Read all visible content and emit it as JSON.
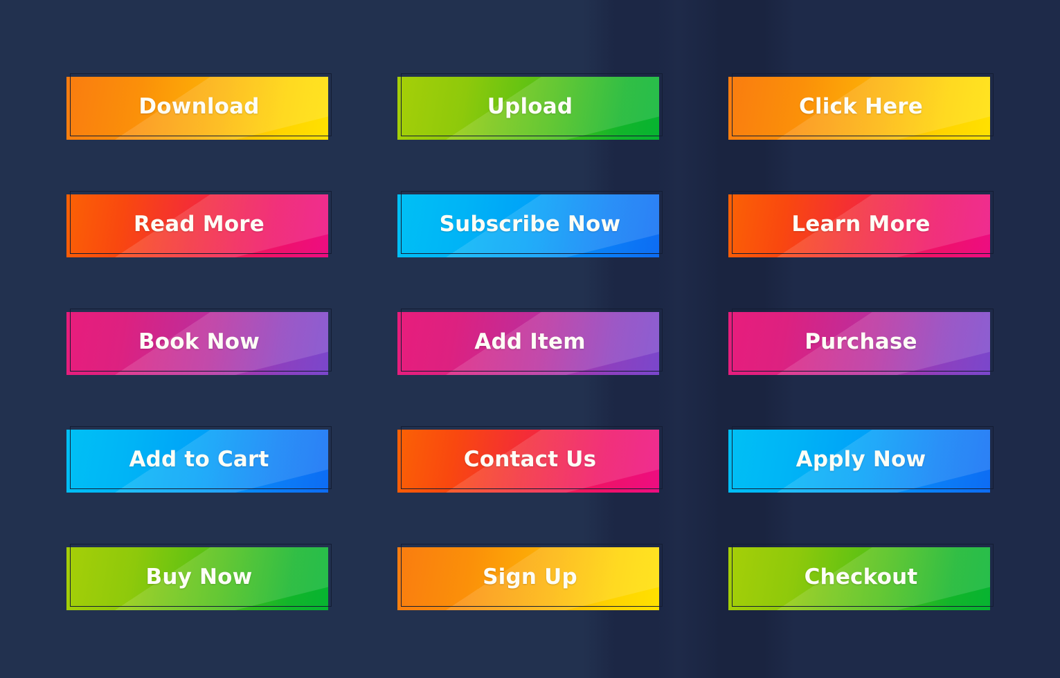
{
  "page": {
    "title": "Gradient Call-To-Action Button Set",
    "background_color": "#1e2a47",
    "columns": 3,
    "rows": 5,
    "total_buttons": 15
  },
  "palette": {
    "orange_yellow": "#f97c10 → #ffe100",
    "lime_green": "#a6cf08 → #06b431",
    "orange_pink": "#fb6205 → #ed0d81",
    "cyan_blue": "#00c0f5 → #0d6cf4",
    "pink_purple": "#e81d7c → #7a47cc",
    "frame_outline": "#131c33",
    "label_color": "#fdfdf6"
  },
  "buttons": [
    {
      "name": "download",
      "label": "Download",
      "gradient": "g-orange-yellow"
    },
    {
      "name": "upload",
      "label": "Upload",
      "gradient": "g-lime-green"
    },
    {
      "name": "click-here",
      "label": "Click Here",
      "gradient": "g-orange-yellow"
    },
    {
      "name": "read-more",
      "label": "Read More",
      "gradient": "g-orange-pink"
    },
    {
      "name": "subscribe-now",
      "label": "Subscribe Now",
      "gradient": "g-cyan-blue"
    },
    {
      "name": "learn-more",
      "label": "Learn More",
      "gradient": "g-orange-pink"
    },
    {
      "name": "book-now",
      "label": "Book Now",
      "gradient": "g-pink-purple"
    },
    {
      "name": "add-item",
      "label": "Add Item",
      "gradient": "g-pink-purple"
    },
    {
      "name": "purchase",
      "label": "Purchase",
      "gradient": "g-pink-purple"
    },
    {
      "name": "add-to-cart",
      "label": "Add to Cart",
      "gradient": "g-cyan-blue"
    },
    {
      "name": "contact-us",
      "label": "Contact Us",
      "gradient": "g-orange-pink"
    },
    {
      "name": "apply-now",
      "label": "Apply Now",
      "gradient": "g-cyan-blue"
    },
    {
      "name": "buy-now",
      "label": "Buy Now",
      "gradient": "g-lime-green"
    },
    {
      "name": "sign-up",
      "label": "Sign Up",
      "gradient": "g-orange-yellow"
    },
    {
      "name": "checkout",
      "label": "Checkout",
      "gradient": "g-lime-green"
    }
  ]
}
